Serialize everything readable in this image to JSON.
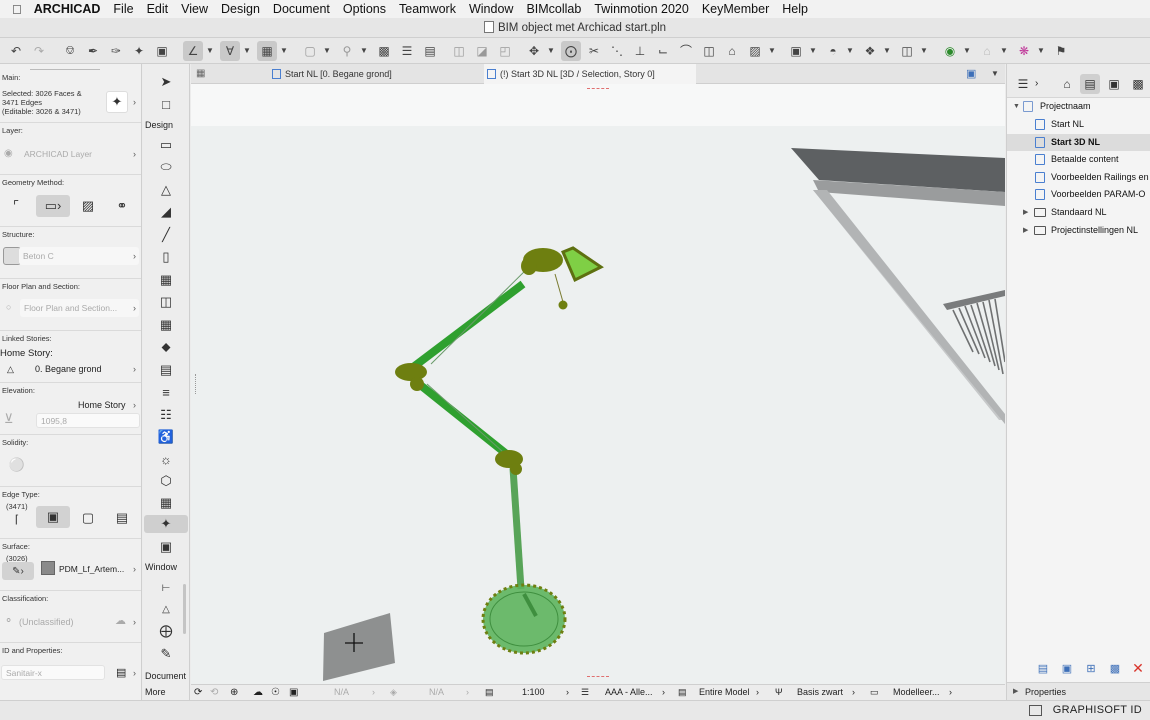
{
  "menubar": {
    "app_name": "ARCHICAD",
    "items": [
      "File",
      "Edit",
      "View",
      "Design",
      "Document",
      "Options",
      "Teamwork",
      "Window",
      "BIMcollab",
      "Twinmotion 2020",
      "KeyMember",
      "Help"
    ]
  },
  "window": {
    "title": "BIM object met Archicad start.pln"
  },
  "tabs": [
    {
      "label": "Start NL [0. Begane grond]",
      "active": false
    },
    {
      "label": "(!) Start 3D NL [3D / Selection, Story 0]",
      "active": true
    }
  ],
  "info_panel": {
    "main_label": "Main:",
    "selected_line1": "Selected: 3026 Faces &",
    "selected_line2": "3471 Edges",
    "selected_line3": "(Editable: 3026 & 3471)",
    "layer_label": "Layer:",
    "layer_value": "ARCHICAD Layer",
    "geometry_label": "Geometry Method:",
    "structure_label": "Structure:",
    "structure_value": "Beton C",
    "floor_plan_label": "Floor Plan and Section:",
    "floor_plan_value": "Floor Plan and Section...",
    "linked_label": "Linked Stories:",
    "home_story_label": "Home Story:",
    "home_story_value": "0. Begane grond",
    "elevation_label": "Elevation:",
    "elevation_ref": "Home Story",
    "elevation_value": "1095,8",
    "solidity_label": "Solidity:",
    "edge_type_label": "Edge Type:",
    "edge_count": "(3471)",
    "surface_label": "Surface:",
    "surface_count": "(3026)",
    "surface_value": "PDM_Lf_Artem...",
    "classification_label": "Classification:",
    "classification_value": "(Unclassified)",
    "id_label": "ID and Properties:",
    "id_value": "Sanitair-x"
  },
  "toolbox": {
    "design_label": "Design",
    "window_label": "Window",
    "document_label": "Document",
    "more_label": "More"
  },
  "view_bar": {
    "na1": "N/A",
    "na2": "N/A",
    "scale": "1:100",
    "layer_combo": "AAA - Alle...",
    "model": "Entire Model",
    "pen_set": "Basis zwart",
    "model_view": "Modelleer..."
  },
  "navigator": {
    "root": "Projectnaam",
    "items": [
      {
        "label": "Start NL",
        "type": "view",
        "selected": false
      },
      {
        "label": "Start 3D NL",
        "type": "view",
        "selected": true
      },
      {
        "label": "Betaalde content",
        "type": "view",
        "selected": false
      },
      {
        "label": "Voorbeelden Railings en",
        "type": "view",
        "selected": false
      },
      {
        "label": "Voorbeelden PARAM-O",
        "type": "view",
        "selected": false
      },
      {
        "label": "Standaard NL",
        "type": "folder",
        "selected": false
      },
      {
        "label": "Projectinstellingen NL",
        "type": "folder",
        "selected": false
      }
    ],
    "properties_label": "Properties"
  },
  "footer": {
    "brand": "GRAPHISOFT ID"
  },
  "colors": {
    "selection_green": "#2fa02f",
    "selection_joint": "#6e7f10",
    "selection_fill": "#7fcf45"
  }
}
